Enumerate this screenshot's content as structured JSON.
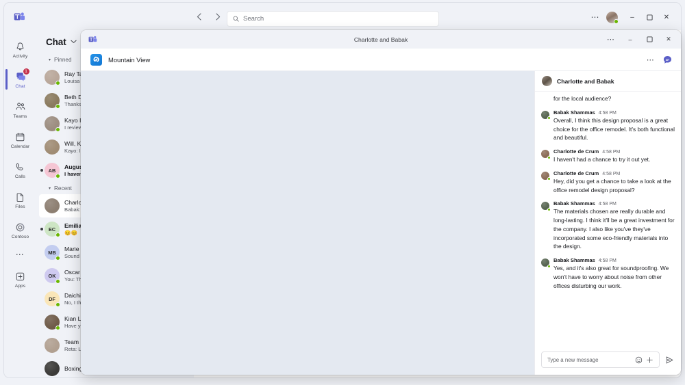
{
  "main_window": {
    "titlebar": {
      "logo_icon": "teams-logo-icon",
      "back_icon": "chevron-left-icon",
      "forward_icon": "chevron-right-icon",
      "search_placeholder": "Search",
      "search_icon": "search-icon",
      "more_icon": "ellipsis-icon",
      "avatar_name": "user-avatar",
      "minimize_label": "–",
      "maximize_label": "❐",
      "close_label": "✕"
    },
    "rail": {
      "items": [
        {
          "label": "Activity",
          "icon": "bell-icon",
          "active": false,
          "badge": ""
        },
        {
          "label": "Chat",
          "icon": "chat-icon",
          "active": true,
          "badge": "1"
        },
        {
          "label": "Teams",
          "icon": "teams-icon",
          "active": false,
          "badge": ""
        },
        {
          "label": "Calendar",
          "icon": "calendar-icon",
          "active": false,
          "badge": ""
        },
        {
          "label": "Calls",
          "icon": "phone-icon",
          "active": false,
          "badge": ""
        },
        {
          "label": "Files",
          "icon": "file-icon",
          "active": false,
          "badge": ""
        },
        {
          "label": "Contoso",
          "icon": "contoso-icon",
          "active": false,
          "badge": ""
        }
      ],
      "more_icon": "ellipsis-icon",
      "apps": {
        "label": "Apps",
        "icon": "apps-plus-icon"
      }
    },
    "chat_list": {
      "title": "Chat",
      "title_chevron": "chevron-down-icon",
      "sections": [
        {
          "label": "Pinned",
          "rows": [
            {
              "name": "Ray Ta",
              "preview": "Louisa",
              "avatar_type": "photo",
              "avatar_color": "#b9a79a",
              "initials": "",
              "unread": false,
              "selected": false,
              "presence": true
            },
            {
              "name": "Beth D",
              "preview": "Thanks",
              "avatar_type": "photo",
              "avatar_color": "#8a7a5e",
              "initials": "",
              "unread": false,
              "selected": false,
              "presence": true
            },
            {
              "name": "Kayo I",
              "preview": "I review",
              "avatar_type": "photo",
              "avatar_color": "#9c8d80",
              "initials": "",
              "unread": false,
              "selected": false,
              "presence": true
            },
            {
              "name": "Will, K",
              "preview": "Kayo: I",
              "avatar_type": "photo",
              "avatar_color": "#a08c74",
              "initials": "",
              "unread": false,
              "selected": false,
              "presence": false
            },
            {
              "name": "Augus",
              "preview": "I haven",
              "avatar_type": "initials",
              "avatar_color": "#f5c6d4",
              "initials": "AB",
              "unread": true,
              "selected": false,
              "presence": true
            }
          ]
        },
        {
          "label": "Recent",
          "rows": [
            {
              "name": "Charlo",
              "preview": "Babak:",
              "avatar_type": "photo",
              "avatar_color": "#8d7f72",
              "initials": "",
              "unread": false,
              "selected": true,
              "presence": false
            },
            {
              "name": "Emilia",
              "preview": "😊😊",
              "avatar_type": "initials",
              "avatar_color": "#cde5c4",
              "initials": "EC",
              "unread": true,
              "selected": false,
              "presence": true
            },
            {
              "name": "Marie",
              "preview": "Sound",
              "avatar_type": "initials",
              "avatar_color": "#c3cdf0",
              "initials": "MB",
              "unread": false,
              "selected": false,
              "presence": true
            },
            {
              "name": "Oscar",
              "preview": "You: Th",
              "avatar_type": "initials",
              "avatar_color": "#cfcaf0",
              "initials": "OK",
              "unread": false,
              "selected": false,
              "presence": true
            },
            {
              "name": "Daichi",
              "preview": "No, I th",
              "avatar_type": "initials",
              "avatar_color": "#fae6b8",
              "initials": "DF",
              "unread": false,
              "selected": false,
              "presence": true
            },
            {
              "name": "Kian L",
              "preview": "Have y",
              "avatar_type": "photo",
              "avatar_color": "#6f5b49",
              "initials": "",
              "unread": false,
              "selected": false,
              "presence": true
            },
            {
              "name": "Team",
              "preview": "Reta: L",
              "avatar_type": "photo",
              "avatar_color": "#b1a091",
              "initials": "",
              "unread": false,
              "selected": false,
              "presence": false
            },
            {
              "name": "Boxing",
              "preview": "",
              "avatar_type": "photo",
              "avatar_color": "#3b3a38",
              "initials": "",
              "unread": false,
              "selected": false,
              "presence": false
            }
          ]
        }
      ]
    }
  },
  "popout_window": {
    "logo_icon": "teams-logo-icon",
    "title": "Charlotte and Babak",
    "more_icon": "ellipsis-icon",
    "minimize_label": "–",
    "maximize_label": "❐",
    "close_label": "✕",
    "app_header": {
      "app_icon": "mountain-view-app-icon",
      "app_name": "Mountain View",
      "more_icon": "ellipsis-icon",
      "chat_bubble_icon": "chat-bubble-icon"
    },
    "chat_panel": {
      "header_title": "Charlotte and Babak",
      "header_avatar": "group-avatar",
      "messages": [
        {
          "author": "",
          "time": "",
          "text": "for the local audience?",
          "continuation": true,
          "avatar_color": ""
        },
        {
          "author": "Babak Shammas",
          "time": "4:58 PM",
          "text": "Overall, I think this design proposal is a great choice for the office remodel. It's both functional and beautiful.",
          "continuation": false,
          "avatar_color": "#55634f"
        },
        {
          "author": "Charlotte de Crum",
          "time": "4:58 PM",
          "text": "I haven't had a chance to try it out yet.",
          "continuation": false,
          "avatar_color": "#8a6a55"
        },
        {
          "author": "Charlotte de Crum",
          "time": "4:58 PM",
          "text": "Hey, did you get a chance to take a look at the office remodel design proposal?",
          "continuation": false,
          "avatar_color": "#8a6a55"
        },
        {
          "author": "Babak Shammas",
          "time": "4:58 PM",
          "text": "The materials chosen are really durable and long-lasting. I think it'll be a great investment for the company. I also like you've they've incorporated some eco-friendly materials into the design.",
          "continuation": false,
          "avatar_color": "#55634f"
        },
        {
          "author": "Babak Shammas",
          "time": "4:58 PM",
          "text": "Yes, and it's also great for soundproofing. We won't have to worry about noise from other offices disturbing our work.",
          "continuation": false,
          "avatar_color": "#55634f"
        }
      ],
      "compose": {
        "placeholder": "Type a new message",
        "emoji_icon": "emoji-icon",
        "plus_icon": "plus-icon",
        "send_icon": "send-icon"
      }
    }
  },
  "colors": {
    "accent": "#5b5fc7",
    "badge": "#c4314b",
    "presence_available": "#6bb700",
    "rail_bg": "#f0f2f7",
    "canvas": "#e4e9f1"
  }
}
